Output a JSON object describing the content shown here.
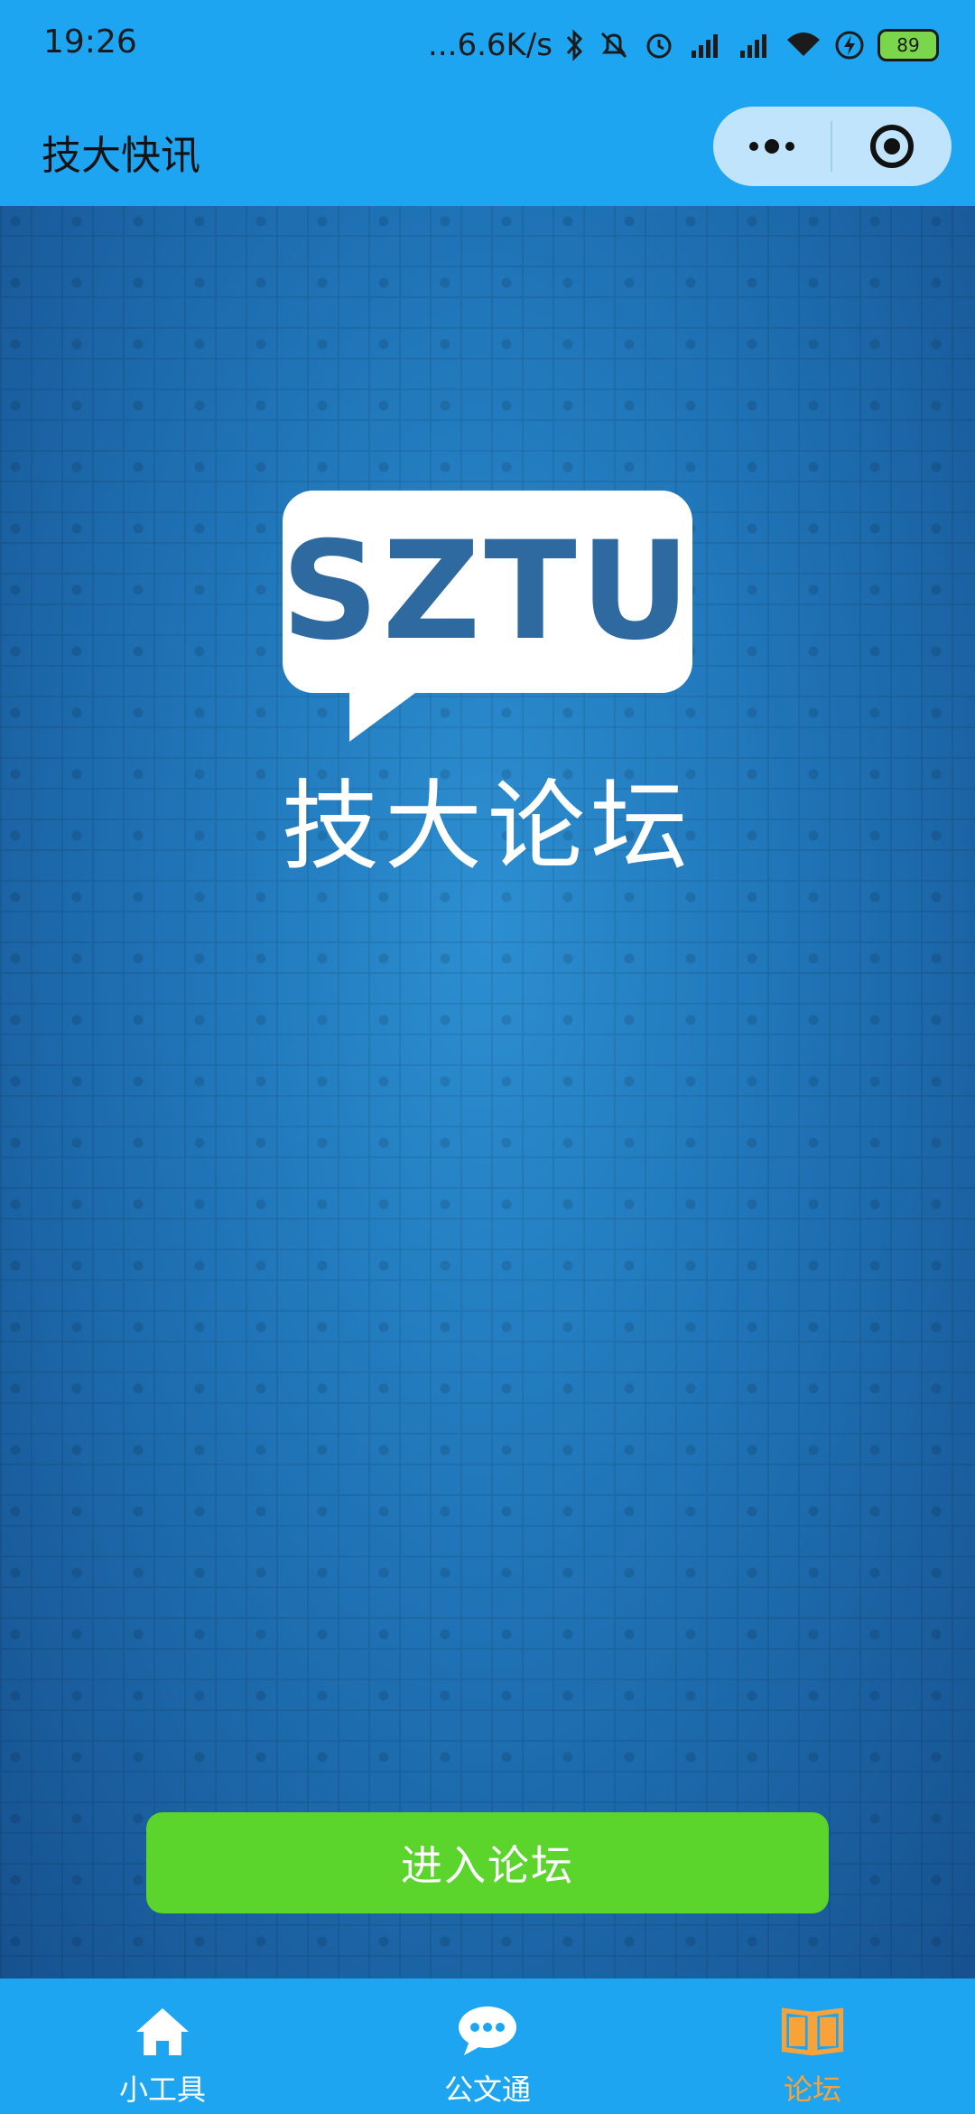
{
  "status_bar": {
    "time": "19:26",
    "network_speed": "...6.6K/s",
    "battery": "89",
    "icons": [
      "bluetooth-icon",
      "mute-icon",
      "alarm-icon",
      "signal-hd-icon",
      "signal-hd-icon",
      "wifi-icon",
      "charging-icon",
      "battery-icon"
    ]
  },
  "title_bar": {
    "title": "技大快讯",
    "more_icon": "more-dots-icon",
    "close_icon": "target-close-icon"
  },
  "main": {
    "logo_text": "SZTU",
    "forum_title": "技大论坛",
    "enter_button": "进入论坛",
    "accent_button_color": "#5bd42c"
  },
  "tab_bar": {
    "tabs": [
      {
        "label": "小工具",
        "icon": "home-icon",
        "active": false
      },
      {
        "label": "公文通",
        "icon": "chat-bubble-icon",
        "active": false
      },
      {
        "label": "论坛",
        "icon": "book-icon",
        "active": true
      }
    ],
    "active_color": "#f7a33a"
  }
}
